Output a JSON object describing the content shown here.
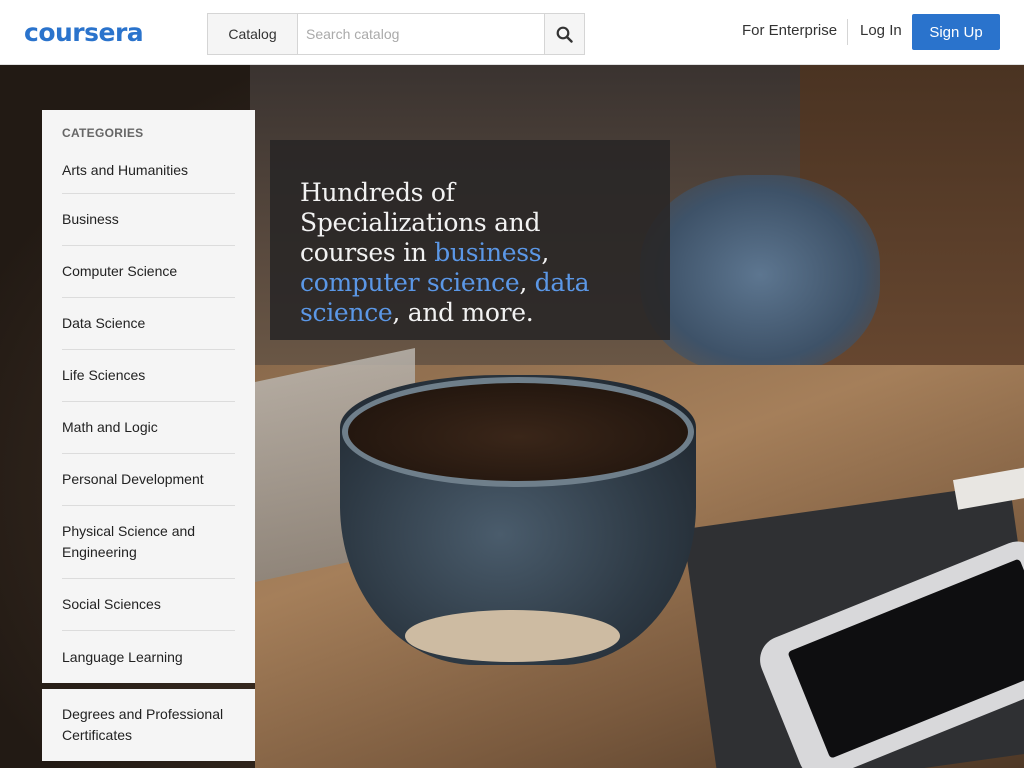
{
  "header": {
    "logo": "coursera",
    "catalog_label": "Catalog",
    "search_placeholder": "Search catalog",
    "search_icon": "search-icon",
    "enterprise_label": "For Enterprise",
    "login_label": "Log In",
    "signup_label": "Sign Up"
  },
  "sidebar": {
    "title": "CATEGORIES",
    "items": [
      {
        "label": "Arts and Humanities"
      },
      {
        "label": "Business"
      },
      {
        "label": "Computer Science"
      },
      {
        "label": "Data Science"
      },
      {
        "label": "Life Sciences"
      },
      {
        "label": "Math and Logic"
      },
      {
        "label": "Personal Development"
      },
      {
        "label": "Physical Science and Engineering"
      },
      {
        "label": "Social Sciences"
      },
      {
        "label": "Language Learning"
      }
    ],
    "degrees_label": "Degrees and Professional Certificates"
  },
  "hero": {
    "text_before": "Hundreds of Specializations and courses in ",
    "link_business": "business",
    "comma1": ", ",
    "link_cs": "computer science",
    "comma2": ", ",
    "link_ds": "data science",
    "text_after": ", and more."
  },
  "colors": {
    "brand": "#2a73cc",
    "link": "#5b97e6"
  }
}
